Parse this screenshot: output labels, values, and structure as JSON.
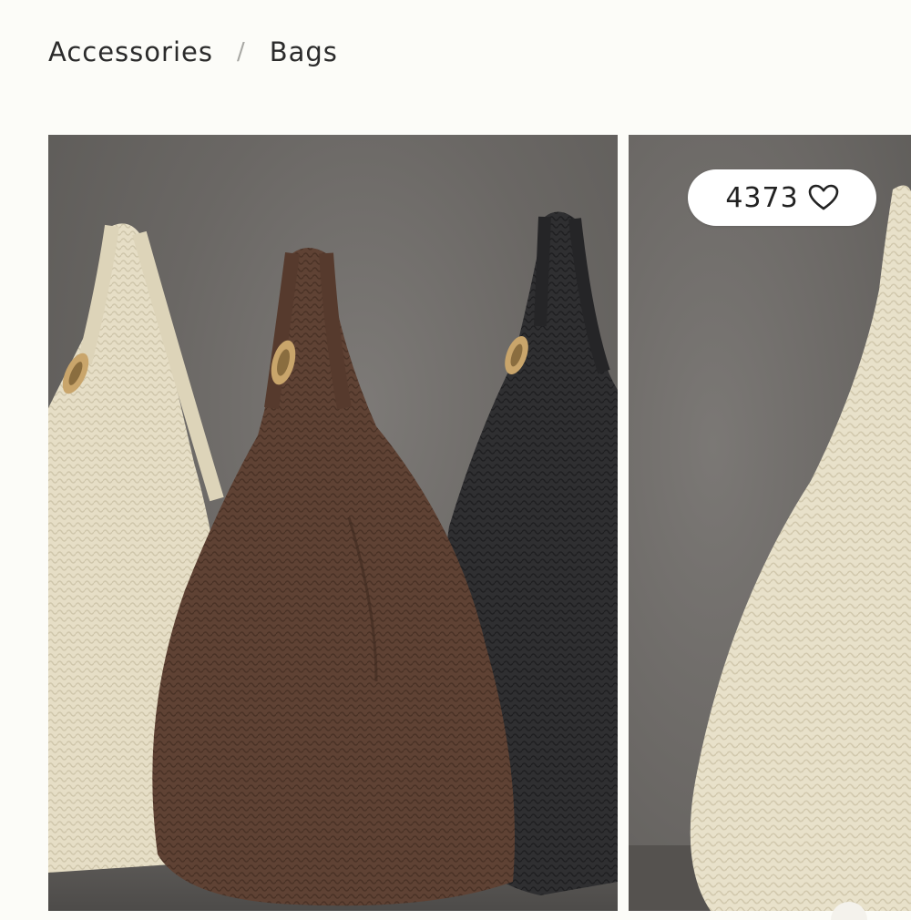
{
  "breadcrumb": {
    "items": [
      "Accessories",
      "Bags"
    ],
    "separator": "/"
  },
  "gallery": {
    "slides": [
      {
        "subject": "three crochet hobo bags: cream, brown, black"
      },
      {
        "subject": "cream crochet hobo bag close-up"
      }
    ]
  },
  "likes": {
    "count": "4373",
    "icon": "heart-outline-icon"
  },
  "colors": {
    "background": "#fcfcf8",
    "cream": "#e9e2cc",
    "brown": "#5e4133",
    "black": "#2c2c2d",
    "hardware": "#c9a56b"
  }
}
